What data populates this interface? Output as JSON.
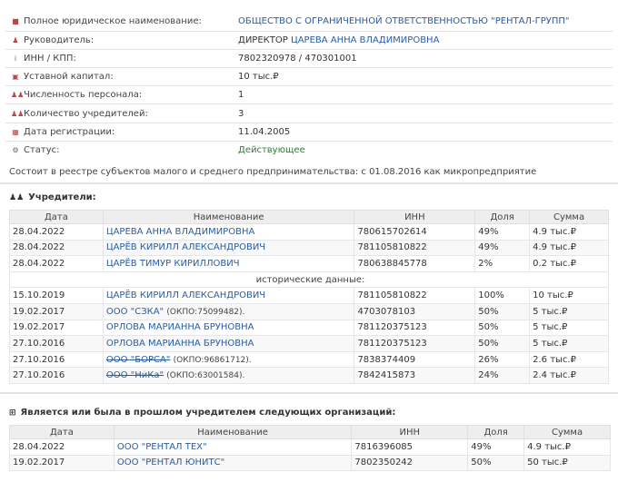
{
  "info": [
    {
      "icon": "■",
      "label": "Полное юридическое наименование:",
      "value": "ОБЩЕСТВО С ОГРАНИЧЕННОЙ ОТВЕТСТВЕННОСТЬЮ \"РЕНТАЛ-ГРУПП\"",
      "link": true
    },
    {
      "icon": "♟",
      "label": "Руководитель:",
      "value_prefix": "ДИРЕКТОР ",
      "value": "ЦАРЕВА АННА ВЛАДИМИРОВНА",
      "link": true
    },
    {
      "icon": "i",
      "label": "ИНН / КПП:",
      "value": "7802320978 / 470301001",
      "link": false
    },
    {
      "icon": "▣",
      "label": "Уставной капитал:",
      "value": "10 тыс.₽",
      "link": false
    },
    {
      "icon": "♟♟",
      "label": "Численность персонала:",
      "value": "1",
      "link": false
    },
    {
      "icon": "♟♟",
      "label": "Количество учредителей:",
      "value": "3",
      "link": false
    },
    {
      "icon": "▦",
      "label": "Дата регистрации:",
      "value": "11.04.2005",
      "link": false
    },
    {
      "icon": "⚙",
      "label": "Статус:",
      "value": "Действующее",
      "link": false,
      "status": true
    }
  ],
  "reestr_text": "Состоит в реестре субъектов малого и среднего предпринимательства: с 01.08.2016 как микропредприятие",
  "founders": {
    "title": "Учредители:",
    "columns": [
      "Дата",
      "Наименование",
      "ИНН",
      "Доля",
      "Сумма"
    ],
    "historic_label": "исторические данные:",
    "current": [
      {
        "date": "28.04.2022",
        "name": "ЦАРЕВА АННА ВЛАДИМИРОВНА",
        "inn": "780615702614",
        "share": "49%",
        "sum": "4.9 тыс.₽"
      },
      {
        "date": "28.04.2022",
        "name": "ЦАРЁВ КИРИЛЛ АЛЕКСАНДРОВИЧ",
        "inn": "781105810822",
        "share": "49%",
        "sum": "4.9 тыс.₽"
      },
      {
        "date": "28.04.2022",
        "name": "ЦАРЁВ ТИМУР КИРИЛЛОВИЧ",
        "inn": "780638845778",
        "share": "2%",
        "sum": "0.2 тыс.₽"
      }
    ],
    "historic": [
      {
        "date": "15.10.2019",
        "name": "ЦАРЁВ КИРИЛЛ АЛЕКСАНДРОВИЧ",
        "okpo": "",
        "inn": "781105810822",
        "share": "100%",
        "sum": "10 тыс.₽",
        "strike": false
      },
      {
        "date": "19.02.2017",
        "name": "ООО \"СЗКА\"",
        "okpo": "(ОКПО:75099482).",
        "inn": "4703078103",
        "share": "50%",
        "sum": "5 тыс.₽",
        "strike": false
      },
      {
        "date": "19.02.2017",
        "name": "ОРЛОВА МАРИАННА БРУНОВНА",
        "okpo": "",
        "inn": "781120375123",
        "share": "50%",
        "sum": "5 тыс.₽",
        "strike": false
      },
      {
        "date": "27.10.2016",
        "name": "ОРЛОВА МАРИАННА БРУНОВНА",
        "okpo": "",
        "inn": "781120375123",
        "share": "50%",
        "sum": "5 тыс.₽",
        "strike": false
      },
      {
        "date": "27.10.2016",
        "name": "ООО \"БОРСА\"",
        "okpo": "(ОКПО:96861712).",
        "inn": "7838374409",
        "share": "26%",
        "sum": "2.6 тыс.₽",
        "strike": true
      },
      {
        "date": "27.10.2016",
        "name": "ООО \"НиКа\"",
        "okpo": "(ОКПО:63001584).",
        "inn": "7842415873",
        "share": "24%",
        "sum": "2.4 тыс.₽",
        "strike": true
      }
    ]
  },
  "founded_orgs": {
    "title": "Является или была в прошлом учредителем следующих организаций:",
    "columns": [
      "Дата",
      "Наименование",
      "ИНН",
      "Доля",
      "Сумма"
    ],
    "rows": [
      {
        "date": "28.04.2022",
        "name": "ООО \"РЕНТАЛ ТЕХ\"",
        "inn": "7816396085",
        "share": "49%",
        "sum": "4.9 тыс.₽"
      },
      {
        "date": "19.02.2017",
        "name": "ООО \"РЕНТАЛ ЮНИТС\"",
        "inn": "7802350242",
        "share": "50%",
        "sum": "50 тыс.₽"
      }
    ]
  },
  "colors": {
    "link": "#2a5d9f",
    "status": "#2e7d32",
    "header_bg": "#eeeeee",
    "icon_red": "#b44444"
  }
}
